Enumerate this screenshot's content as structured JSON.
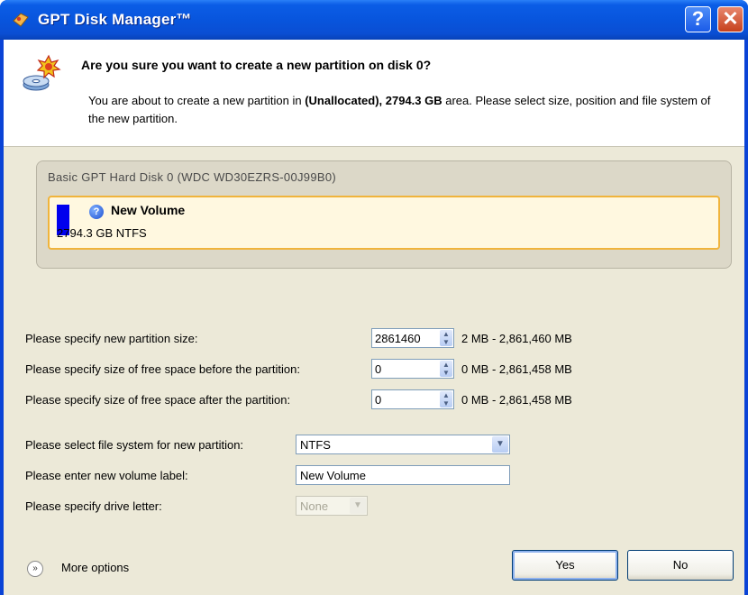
{
  "window": {
    "title": "GPT Disk Manager™",
    "help_glyph": "?",
    "close_glyph": "✕"
  },
  "header": {
    "question": "Are you sure you want to create a new partition on disk 0?",
    "desc_prefix": "You are about to create a new partition in ",
    "desc_area": "(Unallocated), 2794.3 GB",
    "desc_suffix": " area. Please select size, position and file system of the new partition."
  },
  "disk": {
    "title": "Basic GPT Hard Disk 0 (WDC WD30EZRS-00J99B0)",
    "volume_name": "New Volume",
    "volume_size": "2794.3 GB NTFS",
    "volume_color": "#0000ee"
  },
  "form": {
    "size_label": "Please specify new partition size:",
    "size_value": "2861460",
    "size_range": "2 MB - 2,861,460 MB",
    "before_label": "Please specify size of free space before the partition:",
    "before_value": "0",
    "before_range": "0 MB - 2,861,458 MB",
    "after_label": "Please specify size of free space after the partition:",
    "after_value": "0",
    "after_range": "0 MB - 2,861,458 MB",
    "fs_label": "Please select file system for new partition:",
    "fs_value": "NTFS",
    "vol_label_label": "Please enter new volume label:",
    "vol_label_value": "New Volume",
    "drive_letter_label": "Please specify drive letter:",
    "drive_letter_value": "None"
  },
  "footer": {
    "more_options": "More options",
    "yes": "Yes",
    "no": "No"
  }
}
